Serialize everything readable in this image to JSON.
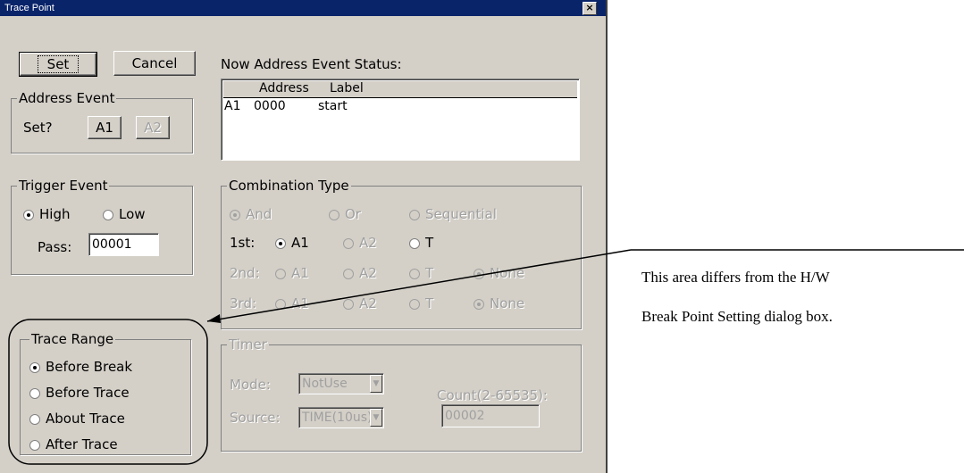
{
  "window": {
    "title": "Trace Point",
    "close_glyph": "×"
  },
  "buttons": {
    "set": "Set",
    "cancel": "Cancel"
  },
  "address_event": {
    "label": "Address Event",
    "set_prompt": "Set?",
    "a1": "A1",
    "a2": "A2"
  },
  "status": {
    "label": "Now Address Event Status:",
    "headers": [
      "Address",
      "Label"
    ],
    "rows": [
      {
        "event": "A1",
        "address": "0000",
        "label": "start"
      }
    ]
  },
  "trigger_event": {
    "label": "Trigger Event",
    "high": "High",
    "low": "Low",
    "selected": "High",
    "pass_label": "Pass:",
    "pass_value": "00001"
  },
  "combination": {
    "label": "Combination Type",
    "types": [
      "And",
      "Or",
      "Sequential"
    ],
    "selected_type": "And",
    "row1": {
      "label": "1st:",
      "options": [
        "A1",
        "A2",
        "T"
      ],
      "selected": "A1"
    },
    "row2": {
      "label": "2nd:",
      "options": [
        "A1",
        "A2",
        "T",
        "None"
      ],
      "selected": "None"
    },
    "row3": {
      "label": "3rd:",
      "options": [
        "A1",
        "A2",
        "T",
        "None"
      ],
      "selected": "None"
    }
  },
  "trace_range": {
    "label": "Trace Range",
    "options": [
      "Before Break",
      "Before Trace",
      "About Trace",
      "After Trace"
    ],
    "selected": "Before Break"
  },
  "timer": {
    "label": "Timer",
    "mode_label": "Mode:",
    "mode_value": "NotUse",
    "source_label": "Source:",
    "source_value": "TIME(10us)",
    "count_label": "Count(2-65535):",
    "count_value": "00002"
  },
  "annotation": {
    "line1": "This area differs from the H/W",
    "line2": "Break Point Setting dialog box."
  },
  "icons": {
    "dropdown": "▼"
  }
}
